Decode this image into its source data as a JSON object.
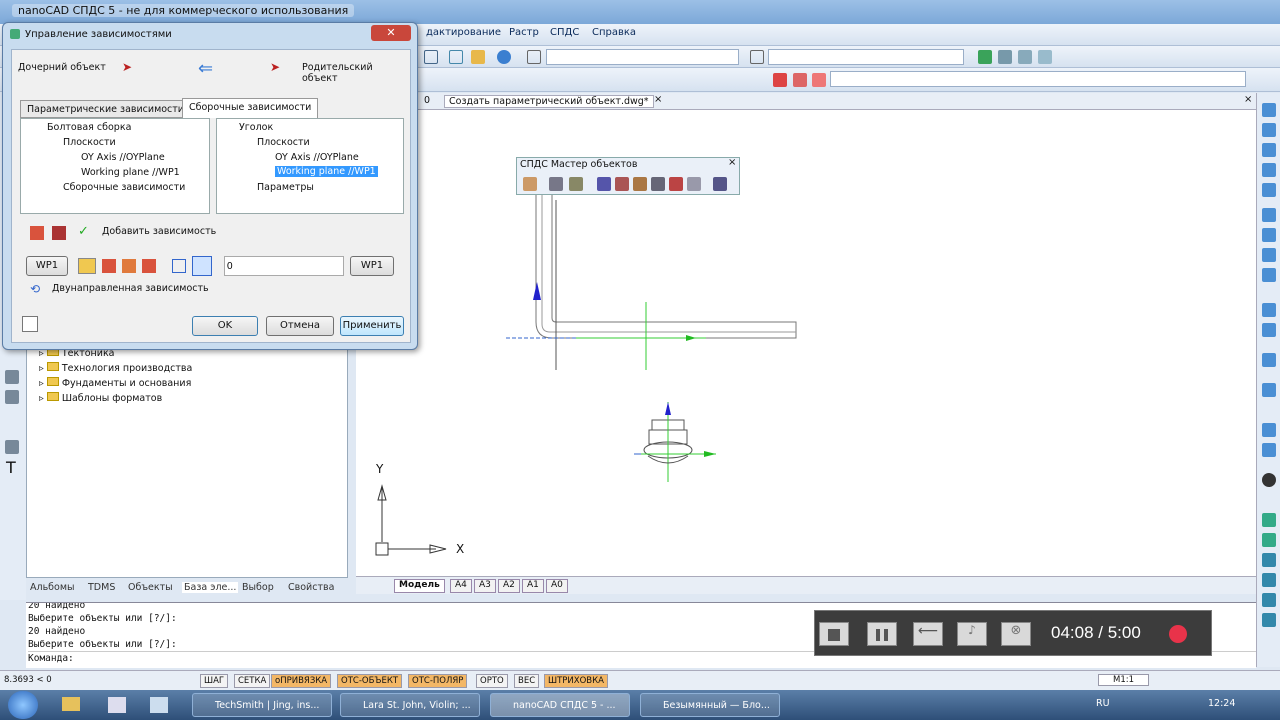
{
  "app": {
    "title": "nanoCAD СПДС 5 - не для коммерческого использования"
  },
  "menu": {
    "items": [
      "дактирование",
      "Растр",
      "СПДС",
      "Справка"
    ]
  },
  "document": {
    "tab_left": "0",
    "tab_name": "Создать параметрический объект.dwg*"
  },
  "dialog": {
    "title": "Управление зависимостями",
    "child_label": "Дочерний объект",
    "parent_label": "Родительский объект",
    "tabs": [
      "Параметрические зависимости",
      "Сборочные зависимости"
    ],
    "left_tree": [
      "Болтовая сборка",
      "Плоскости",
      "OY Axis //OYPlane",
      "Working plane //WP1",
      "Сборочные зависимости"
    ],
    "right_tree": [
      "Уголок",
      "Плоскости",
      "OY Axis //OYPlane",
      "Working plane //WP1",
      "Параметры"
    ],
    "add_dependency_label": "Добавить зависимость",
    "wp_left": "WP1",
    "wp_right": "WP1",
    "offset_value": "0",
    "bidirectional_label": "Двунаправленная зависимость",
    "ok": "OK",
    "cancel": "Отмена",
    "apply": "Применить"
  },
  "wizard": {
    "title": "СПДС Мастер объектов"
  },
  "left_panel": {
    "items": [
      "Тектоника",
      "Технология производства",
      "Фундаменты и основания",
      "Шаблоны форматов"
    ]
  },
  "panel_tabs": [
    "Альбомы",
    "TDMS",
    "Объекты",
    "База эле...",
    "Выбор",
    "Свойства"
  ],
  "layout_tabs": [
    "Модель",
    "A4",
    "A3",
    "A2",
    "A1",
    "A0"
  ],
  "axes": {
    "x": "X",
    "y": "Y"
  },
  "command_lines": [
    "20 найдено",
    "Выберите объекты или [?/]:",
    "20 найдено",
    "Выберите объекты или [?/]:",
    "Команда:"
  ],
  "recorder": {
    "time": "04:08 / 5:00"
  },
  "status": {
    "coords": "8.3693 < 0",
    "buttons": [
      {
        "label": "ШАГ",
        "on": false
      },
      {
        "label": "СЕТКА",
        "on": false
      },
      {
        "label": "оПРИВЯЗКА",
        "on": true
      },
      {
        "label": "ОТС-ОБЪЕКТ",
        "on": true
      },
      {
        "label": "ОТС-ПОЛЯР",
        "on": true
      },
      {
        "label": "ОРТО",
        "on": false
      },
      {
        "label": "ВЕС",
        "on": false
      },
      {
        "label": "ШТРИХОВКА",
        "on": true
      }
    ],
    "scale": "M1:1"
  },
  "taskbar": {
    "tasks": [
      "TechSmith | Jing, ins...",
      "Lara St. John, Violin; ...",
      "nanoCAD СПДС 5 - ...",
      "Безымянный — Бло..."
    ],
    "lang": "RU",
    "clock": "12:24"
  }
}
